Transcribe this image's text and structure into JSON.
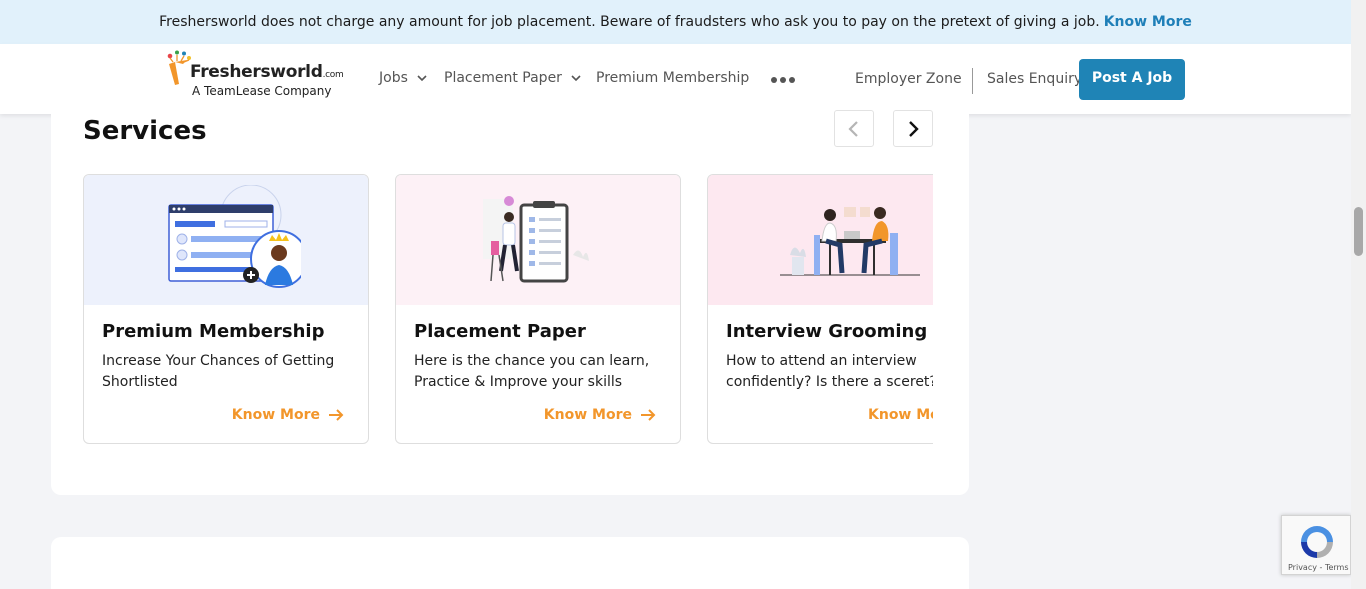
{
  "notice": {
    "text": "Freshersworld does not charge any amount for job placement. Beware of fraudsters who ask you to pay on the pretext of giving a job.",
    "link": "Know More"
  },
  "logo": {
    "brand": "Freshersworld",
    "tld": ".com",
    "tagline": "A TeamLease Company"
  },
  "nav": {
    "items": [
      {
        "label": "Jobs",
        "has_dropdown": true
      },
      {
        "label": "Placement Paper",
        "has_dropdown": true
      },
      {
        "label": "Premium Membership",
        "has_dropdown": false
      }
    ],
    "more_icon": "more-dots-icon",
    "employer_zone": "Employer Zone",
    "sales_enquiry": "Sales Enquiry",
    "post_job": "Post A Job"
  },
  "services": {
    "title": "Services",
    "cards": [
      {
        "title": "Premium Membership",
        "desc": "Increase Your Chances of Getting Shortlisted",
        "link": "Know More",
        "bg": "#edf1fc"
      },
      {
        "title": "Placement Paper",
        "desc": "Here is the chance you can learn, Practice & Improve your skills",
        "link": "Know More",
        "bg": "#fdf1f6"
      },
      {
        "title": "Interview Grooming",
        "desc": "How to attend an interview confidently? Is there a sceret?",
        "link": "Know More",
        "bg": "#fde8f0"
      }
    ]
  },
  "recaptcha": {
    "privacy": "Privacy",
    "sep": " - ",
    "terms": "Terms"
  },
  "colors": {
    "accent_blue": "#1f84b6",
    "link_orange": "#f2962b",
    "notice_bg": "#e1f1fb"
  }
}
